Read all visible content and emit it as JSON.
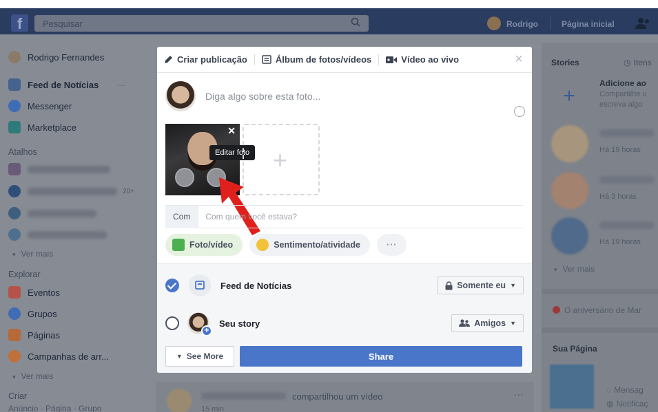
{
  "topbar": {
    "search_placeholder": "Pesquisar",
    "user_name": "Rodrigo",
    "home_label": "Página inicial",
    "brand_color": "#2a3c5f"
  },
  "sidebar": {
    "profile_name": "Rodrigo Fernandes",
    "items": [
      {
        "label": "Feed de Notícias",
        "icon": "news-feed-icon",
        "extra": "···"
      },
      {
        "label": "Messenger",
        "icon": "messenger-icon"
      },
      {
        "label": "Marketplace",
        "icon": "marketplace-icon"
      }
    ],
    "shortcuts_header": "Atalhos",
    "shortcuts_count": "20+",
    "see_more_1": "Ver mais",
    "explore_header": "Explorar",
    "explore_items": [
      {
        "label": "Eventos",
        "icon": "calendar-icon"
      },
      {
        "label": "Grupos",
        "icon": "groups-icon"
      },
      {
        "label": "Páginas",
        "icon": "flag-icon"
      },
      {
        "label": "Campanhas de arr...",
        "icon": "fundraiser-icon"
      }
    ],
    "see_more_2": "Ver mais",
    "create_header": "Criar",
    "create_links": "Anúncio · Página · Grupo"
  },
  "modal": {
    "tabs": [
      "Criar publicação",
      "Álbum de fotos/vídeos",
      "Vídeo ao vivo"
    ],
    "prompt": "Diga algo sobre esta foto...",
    "tooltip": "Editar foto",
    "with_label": "Com",
    "with_placeholder": "Com quem você estava?",
    "chips": {
      "photo": "Foto/vídeo",
      "feeling": "Sentimento/atividade",
      "more": "···"
    },
    "options": [
      {
        "label": "Feed de Notícias",
        "privacy": "Somente eu",
        "checked": true
      },
      {
        "label": "Seu story",
        "privacy": "Amigos",
        "checked": false
      }
    ],
    "see_more": "See More",
    "share": "Share",
    "accent_color": "#4a76c9"
  },
  "right": {
    "stories_title": "Stories",
    "stories_link": "Itens",
    "add_title": "Adicione ao",
    "add_sub_1": "Compartilhe u",
    "add_sub_2": "escreva algo",
    "story_times": [
      "Há 19 horas",
      "Há 3 horas",
      "Há 19 horas"
    ],
    "see_more": "Ver mais",
    "birthday": "O aniversário de Mar",
    "page_title": "Sua Página",
    "page_links": [
      "Mensag",
      "Notificaç"
    ]
  },
  "feed": {
    "post_text": "compartilhou um vídeo",
    "post_time": "15 min",
    "post_more": "···"
  }
}
